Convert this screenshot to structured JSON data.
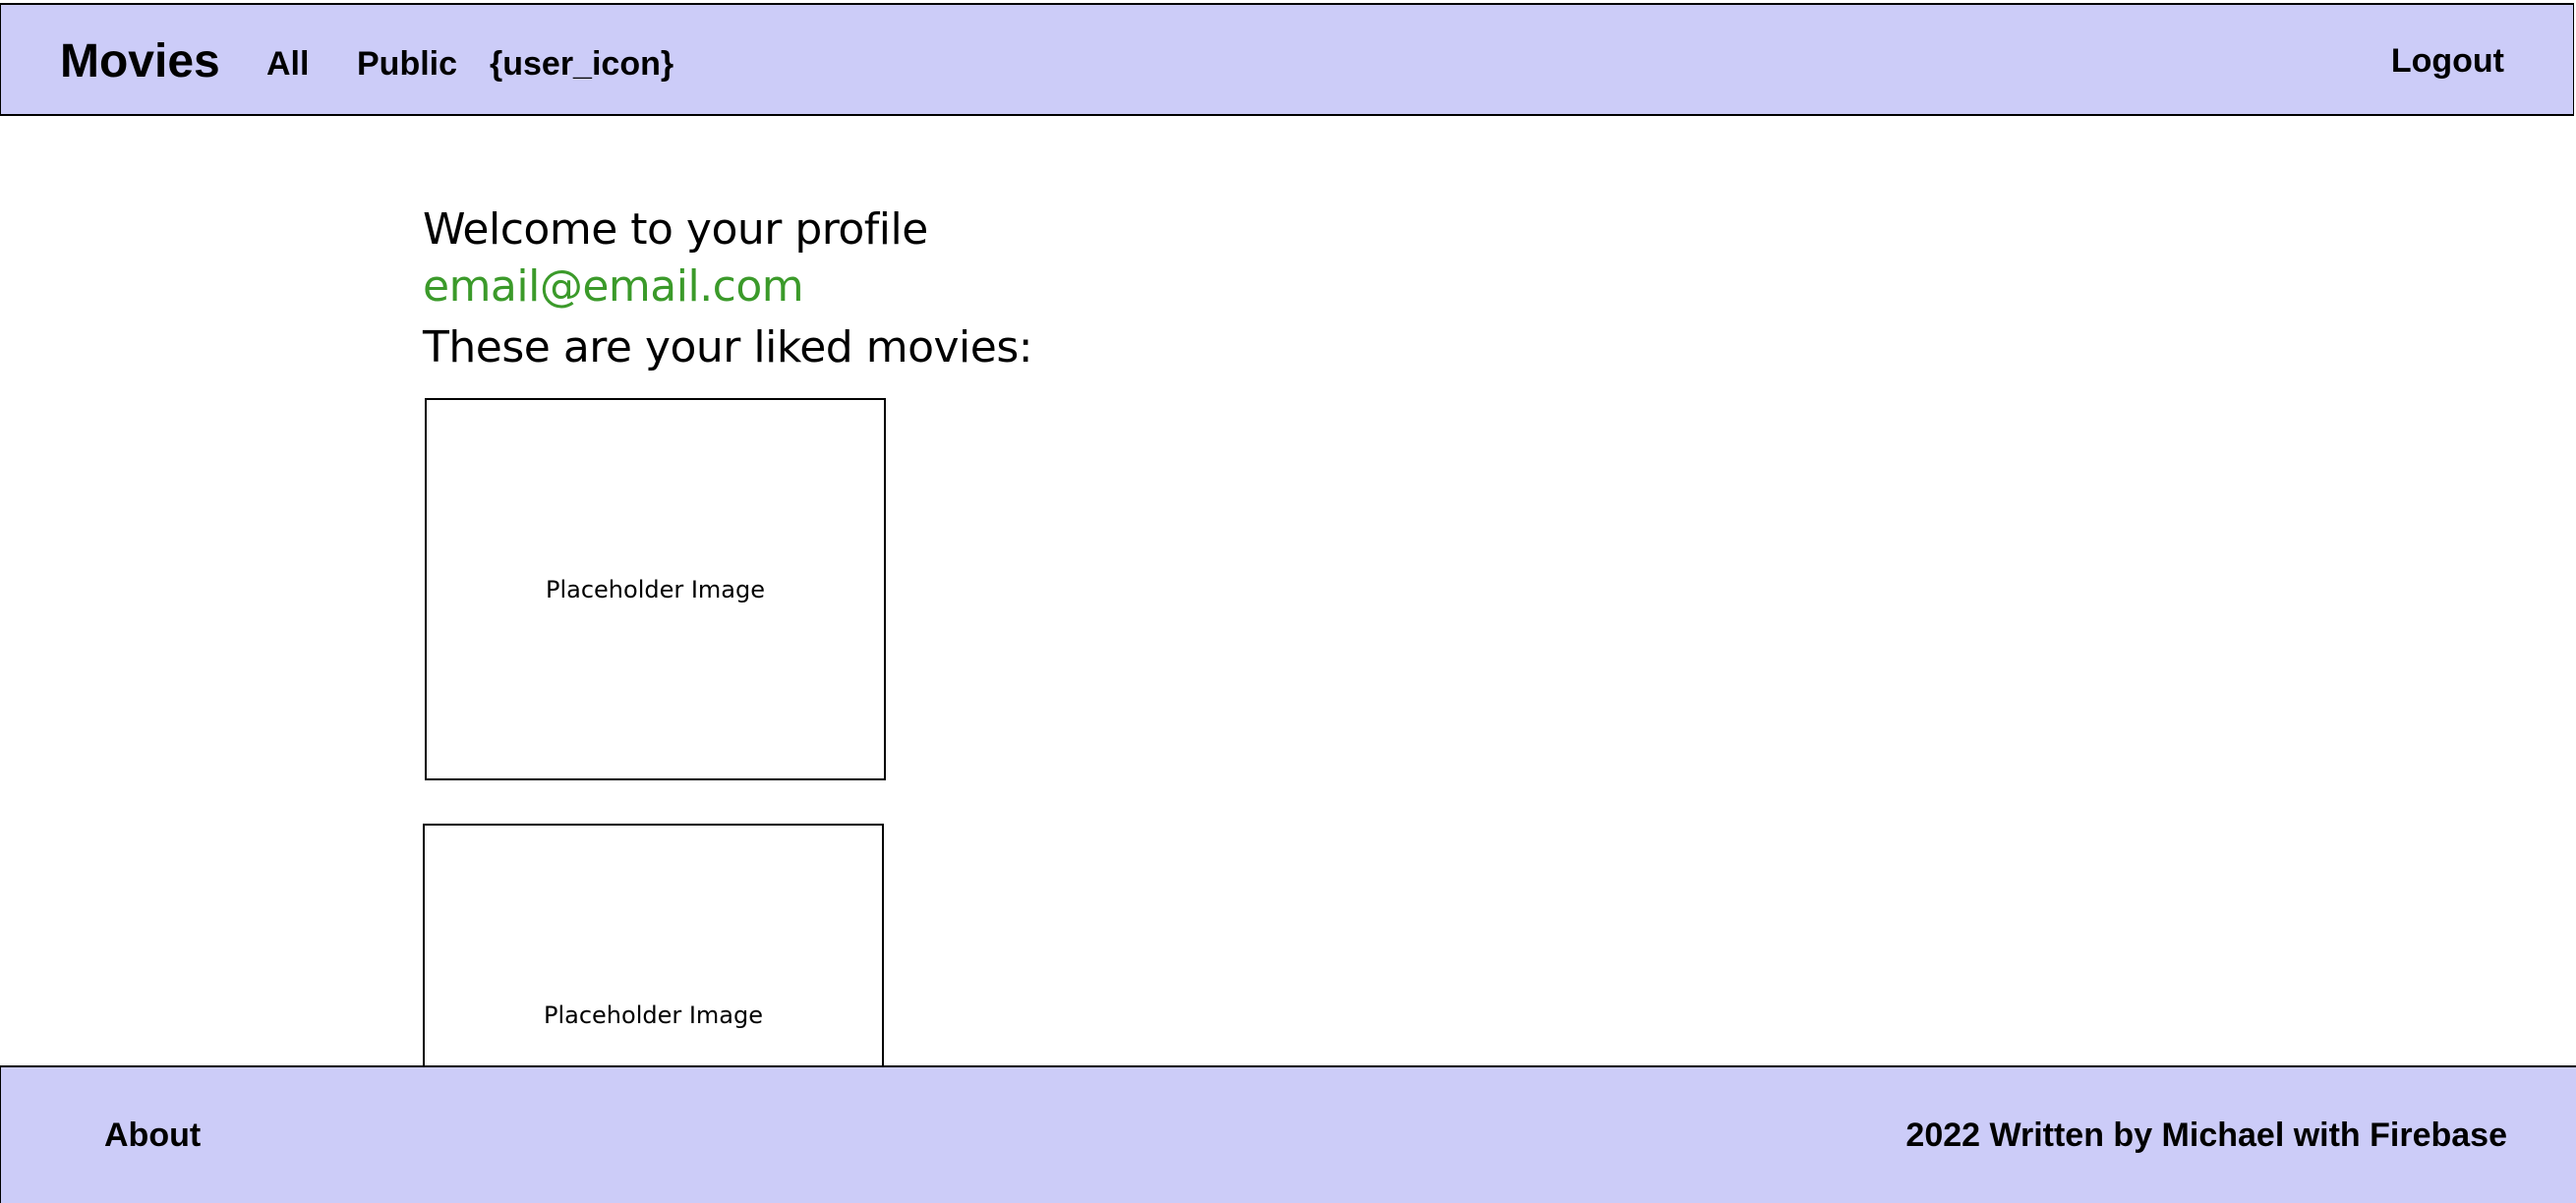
{
  "header": {
    "brand": "Movies",
    "nav": {
      "all": "All",
      "public": "Public",
      "user_icon": "{user_icon}"
    },
    "logout": "Logout"
  },
  "profile": {
    "welcome": "Welcome to your profile",
    "email": "email@email.com",
    "liked_heading": "These are your liked movies:",
    "movies": [
      {
        "image_label": "Placeholder Image"
      },
      {
        "image_label": "Placeholder Image"
      }
    ]
  },
  "footer": {
    "about": "About",
    "credit": "2022 Written by Michael with Firebase"
  },
  "colors": {
    "bar_background": "#ccccf8",
    "email_green": "#3b9a2a"
  }
}
